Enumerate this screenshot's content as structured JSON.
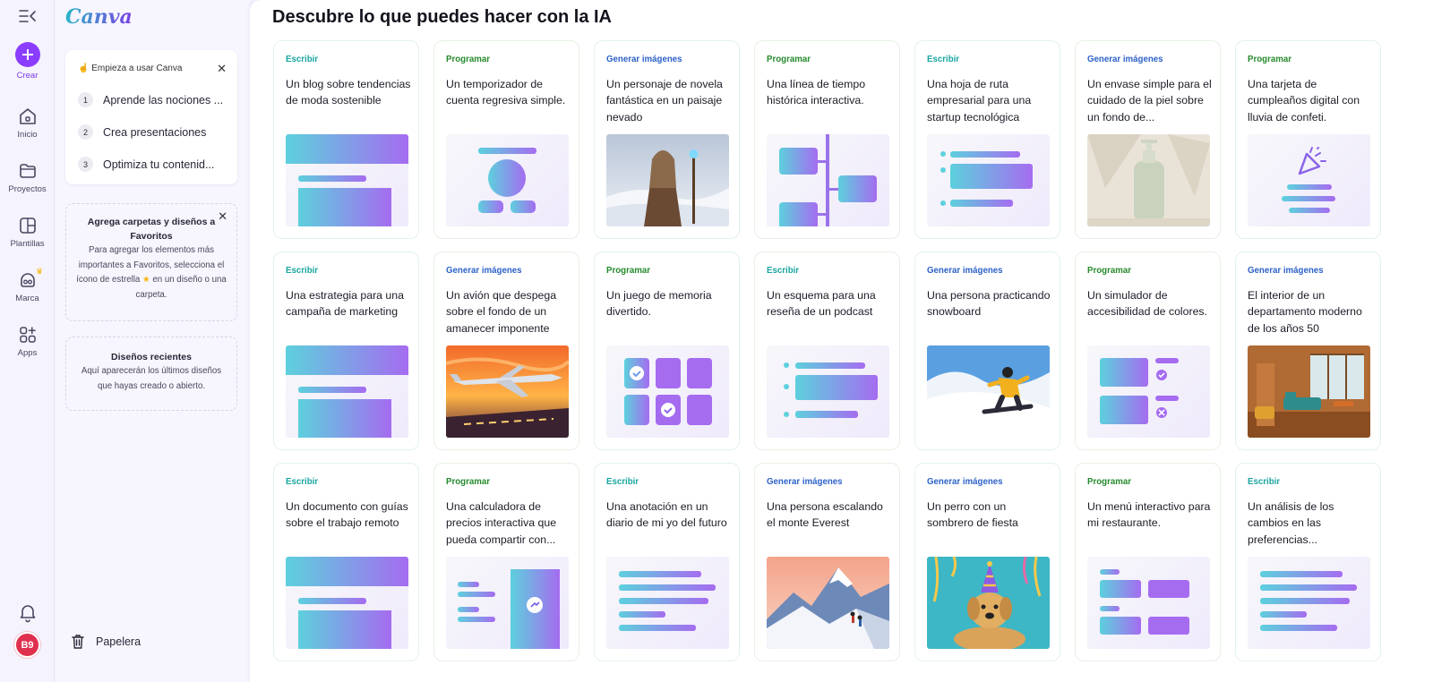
{
  "brand": {
    "logo": "Canva",
    "accent": "#8b3dff"
  },
  "rail": {
    "create": "Crear",
    "items": [
      {
        "label": "Inicio",
        "icon": "home-icon"
      },
      {
        "label": "Proyectos",
        "icon": "folder-icon"
      },
      {
        "label": "Plantillas",
        "icon": "template-icon"
      },
      {
        "label": "Marca",
        "icon": "brand-icon"
      },
      {
        "label": "Apps",
        "icon": "apps-icon"
      }
    ],
    "avatar": "B9"
  },
  "panel": {
    "start": {
      "title": "Empieza a usar Canva",
      "steps": [
        {
          "num": "1",
          "label": "Aprende las nociones ..."
        },
        {
          "num": "2",
          "label": "Crea presentaciones"
        },
        {
          "num": "3",
          "label": "Optimiza tu contenid..."
        }
      ]
    },
    "favorites": {
      "title": "Agrega carpetas y diseños a Favoritos",
      "text_before": "Para agregar los elementos más importantes a Favoritos, selecciona el ícono de estrella",
      "text_after": "en un diseño o una carpeta."
    },
    "recent": {
      "title": "Diseños recientes",
      "text": "Aquí aparecerán los últimos diseños que hayas creado o abierto."
    },
    "trash": "Papelera"
  },
  "main": {
    "title": "Descubre lo que puedes hacer con la IA",
    "cards": [
      {
        "category": "Escribir",
        "kind": "escribir",
        "text": "Un blog sobre tendencias de moda sostenible",
        "thumb": "doc-blocks"
      },
      {
        "category": "Programar",
        "kind": "programar",
        "text": "Un temporizador de cuenta regresiva simple.",
        "thumb": "timer"
      },
      {
        "category": "Generar imágenes",
        "kind": "generar",
        "text": "Un personaje de novela fantástica en un paisaje nevado",
        "thumb": "photo-fantasy"
      },
      {
        "category": "Programar",
        "kind": "programar",
        "text": "Una línea de tiempo histórica interactiva.",
        "thumb": "timeline"
      },
      {
        "category": "Escribir",
        "kind": "escribir",
        "text": "Una hoja de ruta empresarial para una startup tecnológica",
        "thumb": "roadmap"
      },
      {
        "category": "Generar imágenes",
        "kind": "generar",
        "text": "Un envase simple para el cuidado de la piel sobre un fondo de...",
        "thumb": "photo-bottle"
      },
      {
        "category": "Programar",
        "kind": "programar",
        "text": "Una tarjeta de cumpleaños digital con lluvia de confeti.",
        "thumb": "confetti"
      },
      {
        "category": "Escribir",
        "kind": "escribir",
        "text": "Una estrategia para una campaña de marketing",
        "thumb": "doc-blocks"
      },
      {
        "category": "Generar imágenes",
        "kind": "generar",
        "text": "Un avión que despega sobre el fondo de un amanecer imponente",
        "thumb": "photo-plane"
      },
      {
        "category": "Programar",
        "kind": "programar",
        "text": "Un juego de memoria divertido.",
        "thumb": "memory"
      },
      {
        "category": "Escribir",
        "kind": "escribir",
        "text": "Un esquema para una reseña de un podcast",
        "thumb": "outline"
      },
      {
        "category": "Generar imágenes",
        "kind": "generar",
        "text": "Una persona practicando snowboard",
        "thumb": "photo-snowboard"
      },
      {
        "category": "Programar",
        "kind": "programar",
        "text": "Un simulador de accesibilidad de colores.",
        "thumb": "simulator"
      },
      {
        "category": "Generar imágenes",
        "kind": "generar",
        "text": "El interior de un departamento moderno de los años 50",
        "thumb": "photo-interior"
      },
      {
        "category": "Escribir",
        "kind": "escribir",
        "text": "Un documento con guías sobre el trabajo remoto",
        "thumb": "doc-blocks"
      },
      {
        "category": "Programar",
        "kind": "programar",
        "text": "Una calculadora de precios interactiva que pueda compartir con...",
        "thumb": "calculator"
      },
      {
        "category": "Escribir",
        "kind": "escribir",
        "text": "Una anotación en un diario de mi yo del futuro",
        "thumb": "lines"
      },
      {
        "category": "Generar imágenes",
        "kind": "generar",
        "text": "Una persona escalando el monte Everest",
        "thumb": "photo-everest"
      },
      {
        "category": "Generar imágenes",
        "kind": "generar",
        "text": "Un perro con un sombrero de fiesta",
        "thumb": "photo-dog"
      },
      {
        "category": "Programar",
        "kind": "programar",
        "text": "Un menú interactivo para mi restaurante.",
        "thumb": "menu"
      },
      {
        "category": "Escribir",
        "kind": "escribir",
        "text": "Un análisis de los cambios en las preferencias...",
        "thumb": "lines"
      }
    ]
  }
}
